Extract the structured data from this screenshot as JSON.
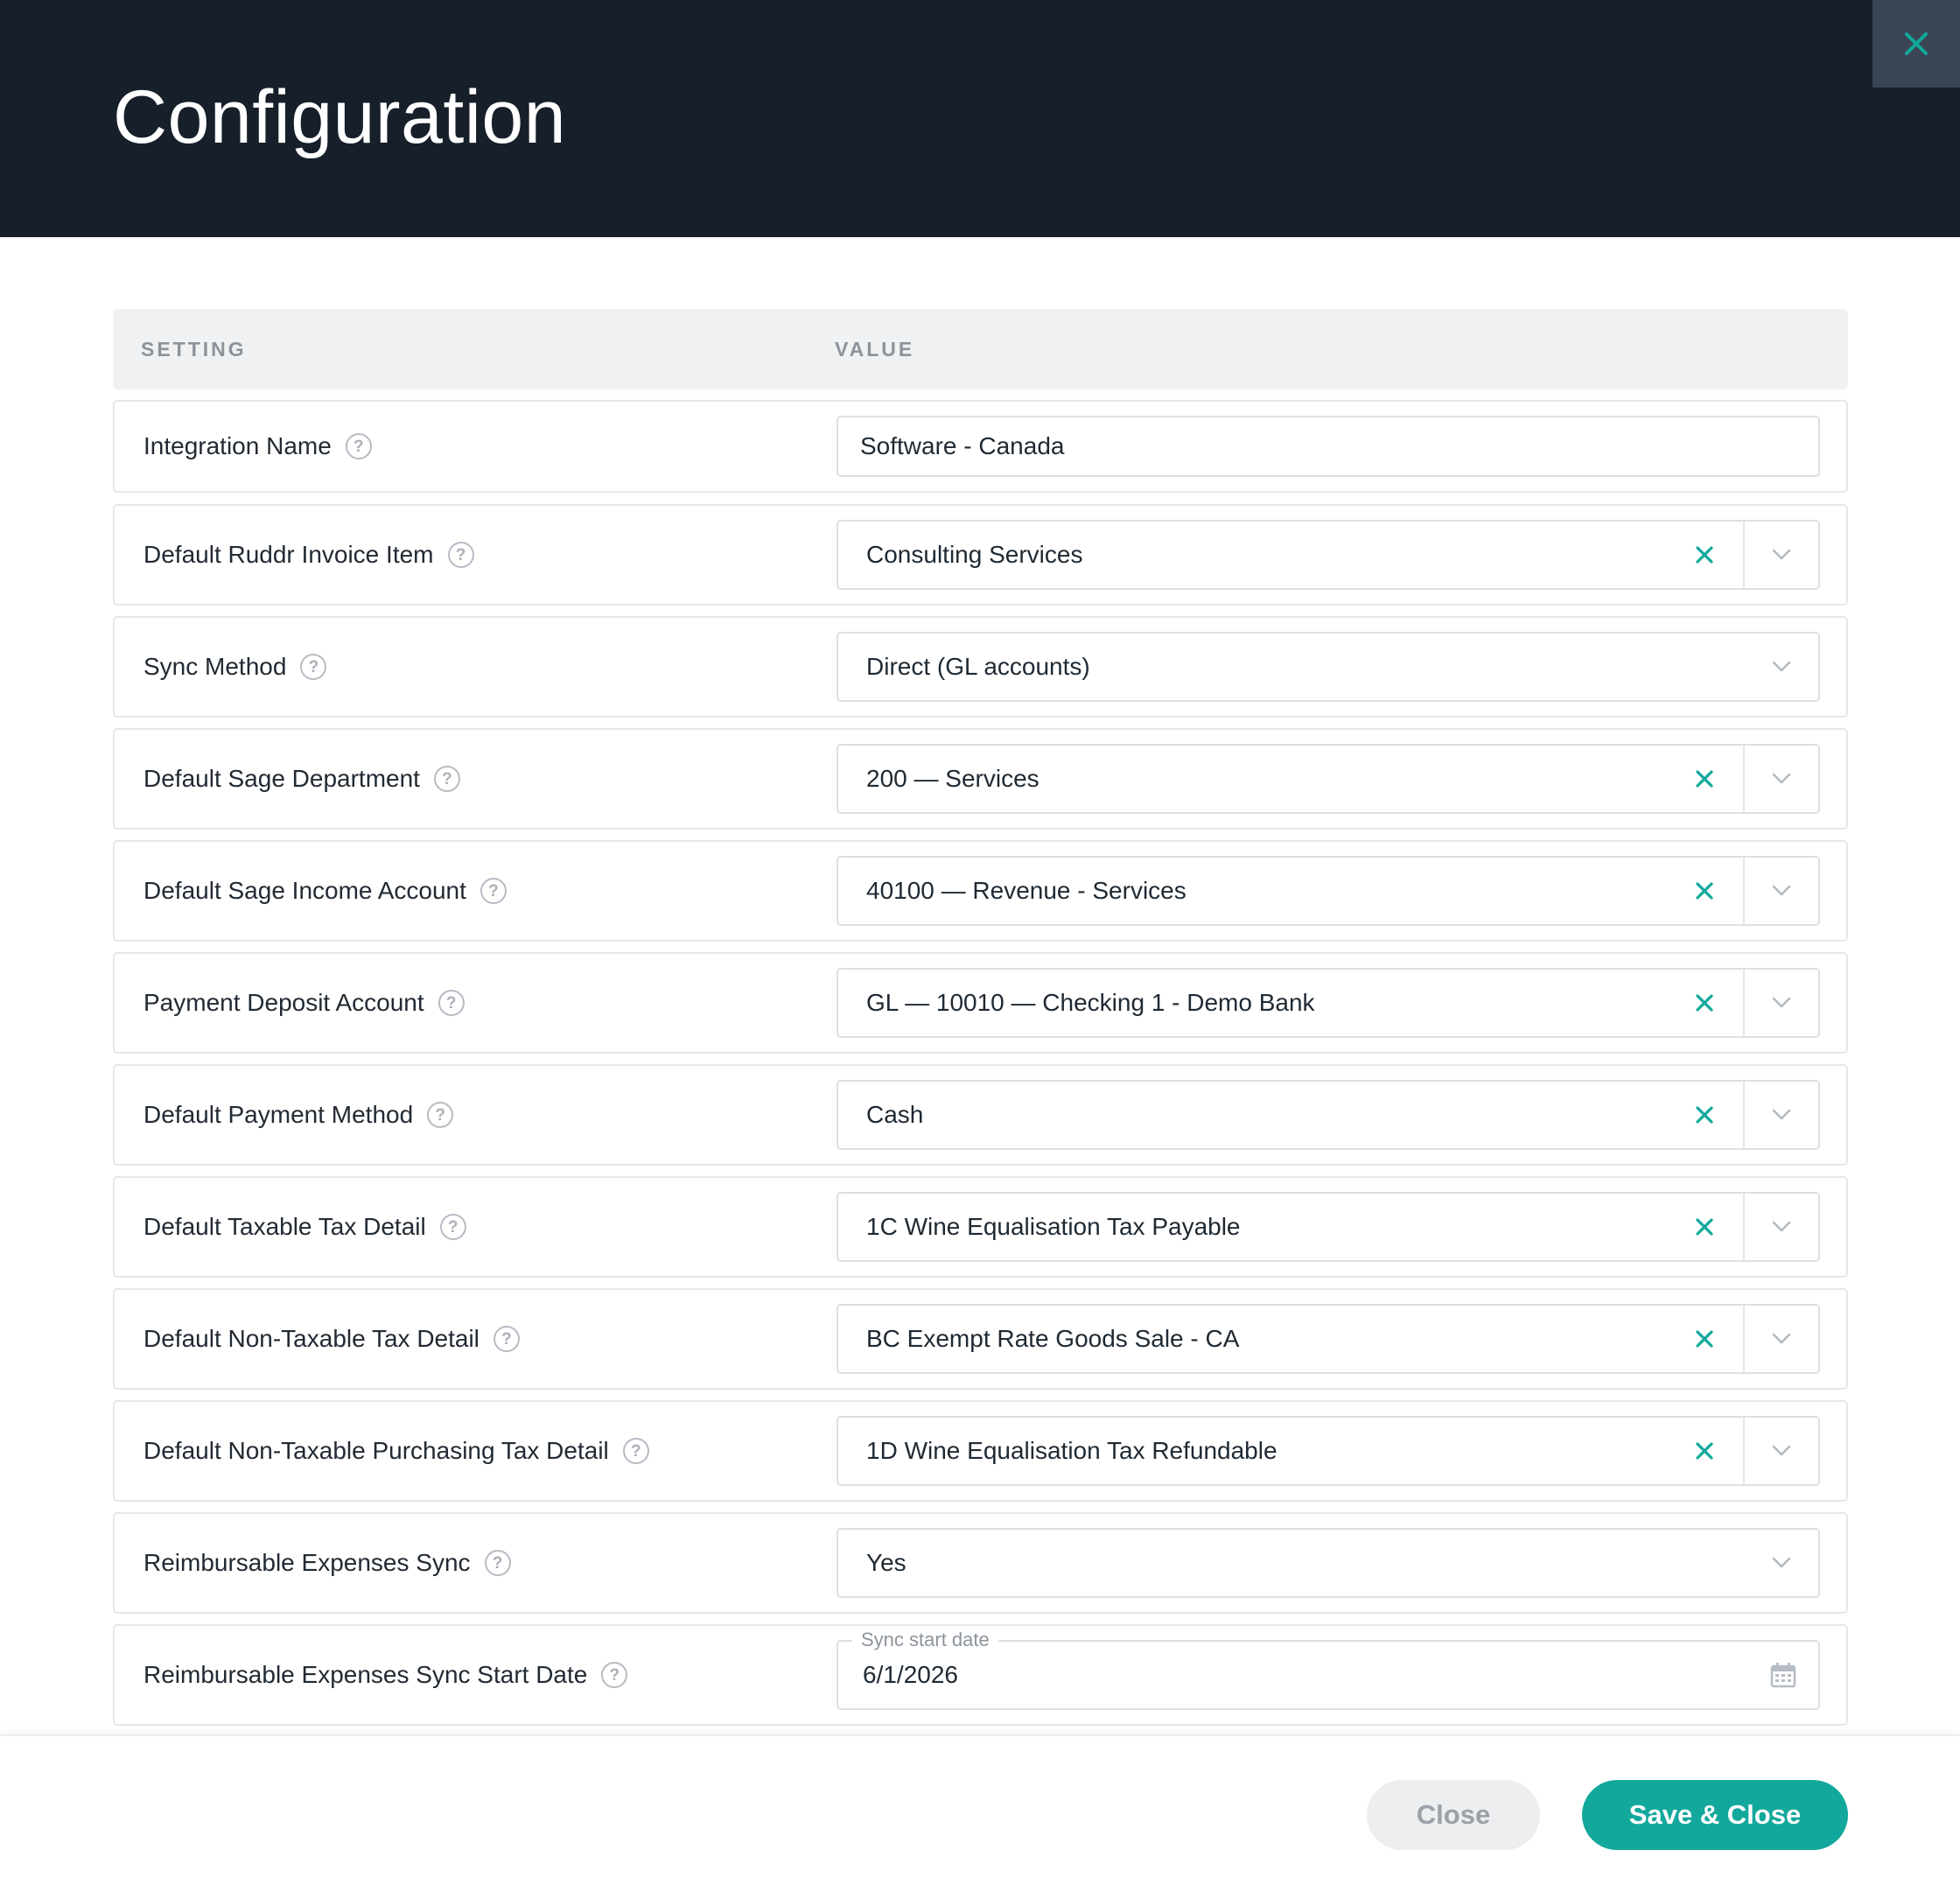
{
  "header": {
    "title": "Configuration"
  },
  "table": {
    "col_setting": "SETTING",
    "col_value": "VALUE"
  },
  "help_glyph": "?",
  "rows": [
    {
      "label": "Integration Name",
      "value": "Software - Canada"
    },
    {
      "label": "Default Ruddr Invoice Item",
      "value": "Consulting Services"
    },
    {
      "label": "Sync Method",
      "value": "Direct (GL accounts)"
    },
    {
      "label": "Default Sage Department",
      "value": "200 — Services"
    },
    {
      "label": "Default Sage Income Account",
      "value": "40100 — Revenue - Services"
    },
    {
      "label": "Payment Deposit Account",
      "value": "GL — 10010 — Checking 1 - Demo Bank"
    },
    {
      "label": "Default Payment Method",
      "value": "Cash"
    },
    {
      "label": "Default Taxable Tax Detail",
      "value": "1C Wine Equalisation Tax Payable"
    },
    {
      "label": "Default Non-Taxable Tax Detail",
      "value": "BC Exempt Rate Goods Sale - CA"
    },
    {
      "label": "Default Non-Taxable Purchasing Tax Detail",
      "value": "1D Wine Equalisation Tax Refundable"
    },
    {
      "label": "Reimbursable Expenses Sync",
      "value": "Yes"
    },
    {
      "label": "Reimbursable Expenses Sync Start Date",
      "value": "6/1/2026",
      "legend": "Sync start date"
    }
  ],
  "footer": {
    "close_label": "Close",
    "save_label": "Save & Close"
  },
  "colors": {
    "accent": "#12a89c",
    "header_bg": "#161f2a"
  }
}
